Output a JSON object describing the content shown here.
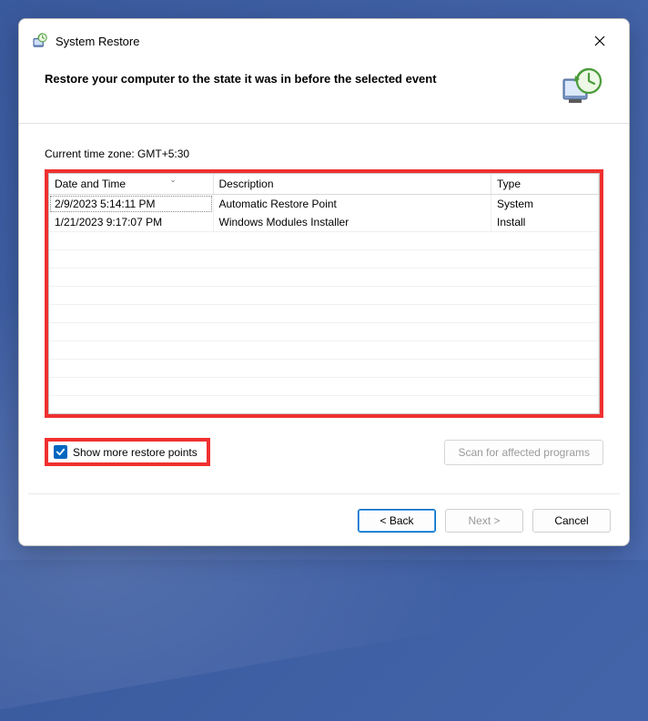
{
  "window": {
    "title": "System Restore"
  },
  "header": {
    "text": "Restore your computer to the state it was in before the selected event"
  },
  "timezone_label": "Current time zone: GMT+5:30",
  "columns": {
    "datetime": "Date and Time",
    "description": "Description",
    "type": "Type"
  },
  "rows": [
    {
      "datetime": "2/9/2023 5:14:11 PM",
      "description": "Automatic Restore Point",
      "type": "System"
    },
    {
      "datetime": "1/21/2023 9:17:07 PM",
      "description": "Windows Modules Installer",
      "type": "Install"
    }
  ],
  "show_more_label": "Show more restore points",
  "scan_button": "Scan for affected programs",
  "buttons": {
    "back": "< Back",
    "next": "Next >",
    "cancel": "Cancel"
  }
}
